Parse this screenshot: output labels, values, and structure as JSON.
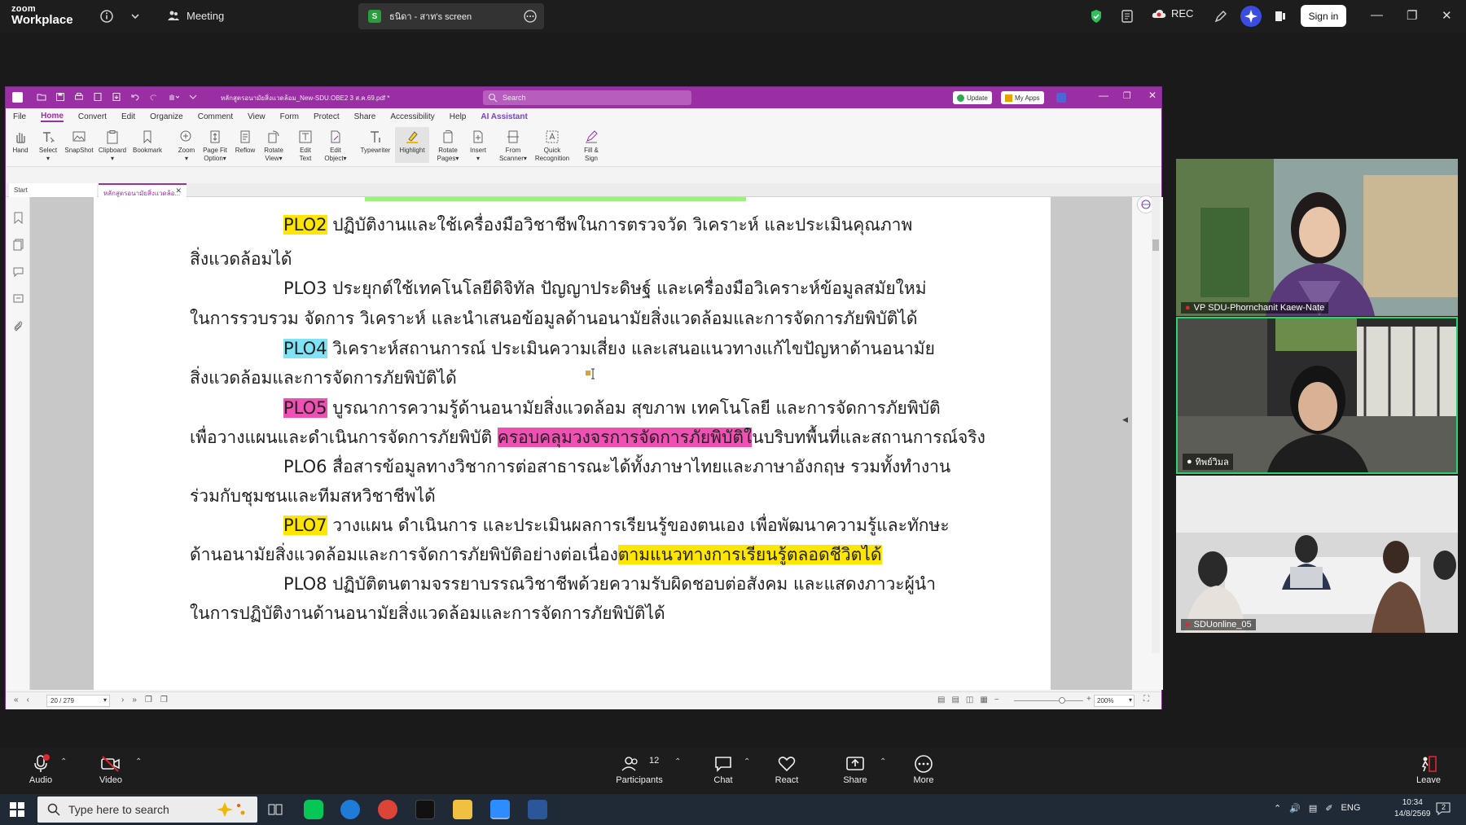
{
  "zoom": {
    "brand_line1": "zoom",
    "brand_line2": "Workplace",
    "meeting_label": "Meeting",
    "share_tab_label": "ธนิดา - สาท's screen",
    "share_badge": "S",
    "rec_label": "REC",
    "sign_in_label": "Sign in"
  },
  "pdf": {
    "title": "หลักสูตรอนามัยสิ่งแวดล้อม_New-SDU.OBE2 3 ส.ค.69.pdf *",
    "search_placeholder": "Search",
    "update_label": "Update",
    "myapps_label": "My Apps",
    "menu": [
      "File",
      "Home",
      "Convert",
      "Edit",
      "Organize",
      "Comment",
      "View",
      "Form",
      "Protect",
      "Share",
      "Accessibility",
      "Help",
      "AI Assistant"
    ],
    "ribbon": [
      {
        "line1": "Hand",
        "line2": ""
      },
      {
        "line1": "Select",
        "line2": "▾"
      },
      {
        "line1": "SnapShot",
        "line2": ""
      },
      {
        "line1": "Clipboard",
        "line2": "▾"
      },
      {
        "line1": "Bookmark",
        "line2": ""
      },
      {
        "line1": "Zoom",
        "line2": "▾"
      },
      {
        "line1": "Page Fit",
        "line2": "Option▾"
      },
      {
        "line1": "Reflow",
        "line2": ""
      },
      {
        "line1": "Rotate",
        "line2": "View▾"
      },
      {
        "line1": "Edit",
        "line2": "Text"
      },
      {
        "line1": "Edit",
        "line2": "Object▾"
      },
      {
        "line1": "Typewriter",
        "line2": ""
      },
      {
        "line1": "Highlight",
        "line2": ""
      },
      {
        "line1": "Rotate",
        "line2": "Pages▾"
      },
      {
        "line1": "Insert",
        "line2": "▾"
      },
      {
        "line1": "From",
        "line2": "Scanner▾"
      },
      {
        "line1": "Quick",
        "line2": "Recognition"
      },
      {
        "line1": "Fill &",
        "line2": "Sign"
      }
    ],
    "tab_start": "Start",
    "tab_doc": "หลักสูตรอนามัยสิ่งแวดล้อ...",
    "page_indicator": "20 / 279",
    "zoom_level": "200%",
    "lines": {
      "l1_tag": "PLO2",
      "l1_rest": " ปฏิบัติงานและใช้เครื่องมือวิชาชีพในการตรวจวัด วิเคราะห์ และประเมินคุณภาพ",
      "l2": "สิ่งแวดล้อมได้",
      "l3": "PLO3 ประยุกต์ใช้เทคโนโลยีดิจิทัล ปัญญาประดิษฐ์ และเครื่องมือวิเคราะห์ข้อมูลสมัยใหม่",
      "l4": "ในการรวบรวม จัดการ วิเคราะห์ และนำเสนอข้อมูลด้านอนามัยสิ่งแวดล้อมและการจัดการภัยพิบัติได้",
      "l5_tag": "PLO4",
      "l5_rest": " วิเคราะห์สถานการณ์ ประเมินความเสี่ยง และเสนอแนวทางแก้ไขปัญหาด้านอนามัย",
      "l6": "สิ่งแวดล้อมและการจัดการภัยพิบัติได้",
      "l7_tag": "PLO5",
      "l7_rest": " บูรณาการความรู้ด้านอนามัยสิ่งแวดล้อม สุขภาพ เทคโนโลยี และการจัดการภัยพิบัติ",
      "l8_a": "เพื่อวางแผนและดำเนินการจัดการภัยพิบัติ ",
      "l8_hl": "ครอบคลุมวงจรการจัดการภัยพิบัติใ",
      "l8_b": "นบริบทพื้นที่และสถานการณ์จริง",
      "l9": "PLO6 สื่อสารข้อมูลทางวิชาการต่อสาธารณะได้ทั้งภาษาไทยและภาษาอังกฤษ รวมทั้งทำงาน",
      "l10": "ร่วมกับชุมชนและทีมสหวิชาชีพได้",
      "l11_tag": "PLO7",
      "l11_rest": " วางแผน ดำเนินการ และประเมินผลการเรียนรู้ของตนเอง เพื่อพัฒนาความรู้และทักษะ",
      "l12_a": "ด้านอนามัยสิ่งแวดล้อมและการจัดการภัยพิบัติอย่างต่อเนื่อง",
      "l12_hl": "ตามแนวทางการเรียนรู้ตลอดชีวิตได้",
      "l13": "PLO8 ปฏิบัติตนตามจรรยาบรรณวิชาชีพด้วยความรับผิดชอบต่อสังคม และแสดงภาวะผู้นำ",
      "l14": "ในการปฏิบัติงานด้านอนามัยสิ่งแวดล้อมและการจัดการภัยพิบัติได้"
    }
  },
  "participants_video": [
    {
      "name": "VP SDU-Phornchanit Kaew-Nate"
    },
    {
      "name": "ทิพย์วิมล"
    },
    {
      "name": "SDUonline_05"
    }
  ],
  "controls": {
    "audio": "Audio",
    "video": "Video",
    "participants": "Participants",
    "participants_count": "12",
    "chat": "Chat",
    "react": "React",
    "share": "Share",
    "more": "More",
    "leave": "Leave"
  },
  "taskbar": {
    "search_placeholder": "Type here to search",
    "lang": "ENG",
    "time": "10:34",
    "date": "14/8/2569",
    "notif_count": "2"
  },
  "colors": {
    "pdf_accent": "#9a2fa3",
    "highlight_yellow": "#ffe600",
    "highlight_cyan": "#7fe3f5",
    "highlight_magenta": "#f04fb3",
    "highlight_green": "#9ef07c",
    "active_speaker_border": "#2bd36b"
  }
}
